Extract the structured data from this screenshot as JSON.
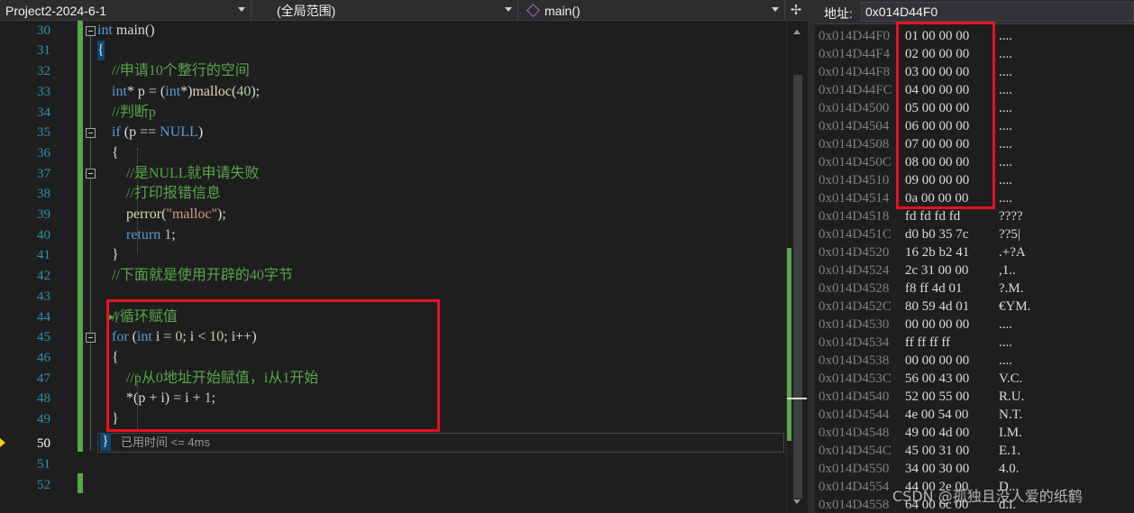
{
  "navbar": {
    "project": "Project2-2024-6-1",
    "scope": "(全局范围)",
    "function": "main()"
  },
  "editor": {
    "line_numbers": [
      "30",
      "31",
      "32",
      "33",
      "34",
      "35",
      "36",
      "37",
      "38",
      "39",
      "40",
      "41",
      "42",
      "43",
      "44",
      "45",
      "46",
      "47",
      "48",
      "49",
      "50",
      "51",
      "52"
    ],
    "current_line": "50",
    "elapsed": "已用时间 <= 4ms",
    "closing_brace": "}"
  },
  "memory": {
    "address_label": "地址:",
    "address_value": "0x014D44F0",
    "rows": [
      {
        "addr": "0x014D44F0",
        "bytes": "01 00 00 00",
        "ascii": "...."
      },
      {
        "addr": "0x014D44F4",
        "bytes": "02 00 00 00",
        "ascii": "...."
      },
      {
        "addr": "0x014D44F8",
        "bytes": "03 00 00 00",
        "ascii": "...."
      },
      {
        "addr": "0x014D44FC",
        "bytes": "04 00 00 00",
        "ascii": "...."
      },
      {
        "addr": "0x014D4500",
        "bytes": "05 00 00 00",
        "ascii": "...."
      },
      {
        "addr": "0x014D4504",
        "bytes": "06 00 00 00",
        "ascii": "...."
      },
      {
        "addr": "0x014D4508",
        "bytes": "07 00 00 00",
        "ascii": "...."
      },
      {
        "addr": "0x014D450C",
        "bytes": "08 00 00 00",
        "ascii": "...."
      },
      {
        "addr": "0x014D4510",
        "bytes": "09 00 00 00",
        "ascii": "...."
      },
      {
        "addr": "0x014D4514",
        "bytes": "0a 00 00 00",
        "ascii": "...."
      },
      {
        "addr": "0x014D4518",
        "bytes": "fd fd fd fd",
        "ascii": "????"
      },
      {
        "addr": "0x014D451C",
        "bytes": "d0 b0 35 7c",
        "ascii": "??5|"
      },
      {
        "addr": "0x014D4520",
        "bytes": "16 2b b2 41",
        "ascii": ".+?A"
      },
      {
        "addr": "0x014D4524",
        "bytes": "2c 31 00 00",
        "ascii": ",1.."
      },
      {
        "addr": "0x014D4528",
        "bytes": "f8 ff 4d 01",
        "ascii": "?.M."
      },
      {
        "addr": "0x014D452C",
        "bytes": "80 59 4d 01",
        "ascii": "€YM."
      },
      {
        "addr": "0x014D4530",
        "bytes": "00 00 00 00",
        "ascii": "...."
      },
      {
        "addr": "0x014D4534",
        "bytes": "ff ff ff ff",
        "ascii": "...."
      },
      {
        "addr": "0x014D4538",
        "bytes": "00 00 00 00",
        "ascii": "...."
      },
      {
        "addr": "0x014D453C",
        "bytes": "56 00 43 00",
        "ascii": "V.C."
      },
      {
        "addr": "0x014D4540",
        "bytes": "52 00 55 00",
        "ascii": "R.U."
      },
      {
        "addr": "0x014D4544",
        "bytes": "4e 00 54 00",
        "ascii": "N.T."
      },
      {
        "addr": "0x014D4548",
        "bytes": "49 00 4d 00",
        "ascii": "I.M."
      },
      {
        "addr": "0x014D454C",
        "bytes": "45 00 31 00",
        "ascii": "E.1."
      },
      {
        "addr": "0x014D4550",
        "bytes": "34 00 30 00",
        "ascii": "4.0."
      },
      {
        "addr": "0x014D4554",
        "bytes": "44 00 2e 00",
        "ascii": "D..."
      },
      {
        "addr": "0x014D4558",
        "bytes": "64 00 6c 00",
        "ascii": "d.l."
      }
    ]
  },
  "watermark": "CSDN @孤独且没人爱的纸鹤",
  "colors": {
    "keyword": "#569cd6",
    "comment": "#57a64a",
    "string": "#d69d85",
    "highlight_box": "#e81123"
  }
}
